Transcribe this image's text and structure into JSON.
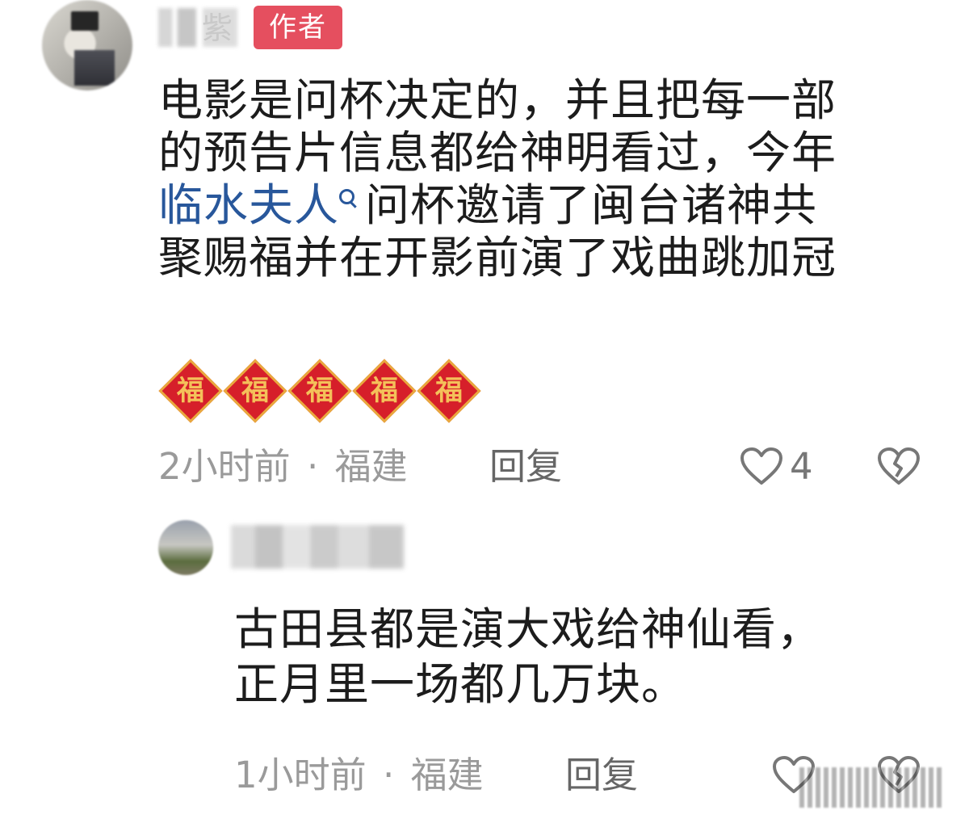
{
  "main_comment": {
    "author_suffix": "紫",
    "author_tag": "作者",
    "text_lines": [
      "电影是问杯决定的，并且把每一部",
      "的预告片信息都给神明看过，今年"
    ],
    "topic_link": "临水夫人",
    "line3_rest": "问杯邀请了闽台诸神共",
    "line4": "聚赐福并在开影前演了戏曲跳加冠",
    "emoji": [
      "福",
      "福",
      "福",
      "福",
      "福"
    ],
    "time": "2小时前",
    "dot": "·",
    "location": "福建",
    "reply_label": "回复",
    "like_count": "4"
  },
  "reply_comment": {
    "text_lines": [
      "古田县都是演大戏给神仙看，",
      "正月里一场都几万块。"
    ],
    "time": "1小时前",
    "dot": "·",
    "location": "福建",
    "reply_label": "回复"
  },
  "colors": {
    "author_tag_bg": "#e54f5f",
    "link": "#28579b",
    "meta_gray": "#9a9a9a"
  }
}
